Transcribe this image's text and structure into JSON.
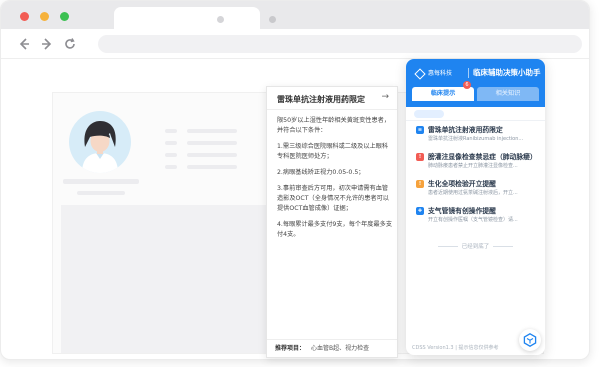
{
  "browser": {
    "controls": {
      "close_color": "#f25c54",
      "minimize_color": "#f6b23c",
      "maximize_color": "#3cc052"
    },
    "nav_icons": {
      "back": "arrow-left-icon",
      "forward": "arrow-right-icon",
      "reload": "reload-icon"
    }
  },
  "popup": {
    "title": "雷珠单抗注射液用药限定",
    "paragraphs": [
      "限50岁以上湿性年龄相关黄斑变性患者，并符合以下条件：",
      "1.需三级综合医院眼科或二级及以上眼科专科医院医师处方；",
      "2.病眼基线矫正视力0.05-0.5；",
      "3.事前审查后方可用，初次申请需有血管造影及OCT（全身情况不允许的患者可以提供OCT血管成像）证据；",
      "4.每眼累计最多支付9支，每个年度最多支付4支。"
    ],
    "footer_label": "推荐项目：",
    "footer_items": "心血管B超、视力检查"
  },
  "cdss": {
    "brand": "惠每科技",
    "title": "临床辅助决策小助手",
    "tabs": [
      {
        "label": "临床提示",
        "badge": "6"
      },
      {
        "label": "相关知识"
      }
    ],
    "alerts": [
      {
        "title": "雷珠单抗注射液用药限定",
        "desc": "雷珠单抗注射液Ranibizumab injection...",
        "icon_color": "#1f84f0"
      },
      {
        "title": "膀灌注显像检查禁忌症（肺动脉瘘）",
        "desc": "肺动脉瘘患者禁止开立肺灌注显像检查...",
        "icon_color": "#f25c54"
      },
      {
        "title": "生化全项检验开立提醒",
        "desc": "患者近期使用过氨茶碱注射液后，开立...",
        "icon_color": "#f6a23c"
      },
      {
        "title": "支气管镜有创操作提醒",
        "desc": "开立有创操作医嘱（支气管镜检查）请...",
        "icon_color": "#1f84f0"
      }
    ],
    "bottom_note": "已经到底了",
    "footer": "CDSS Version1.3 | 提示信息仅供参考"
  }
}
